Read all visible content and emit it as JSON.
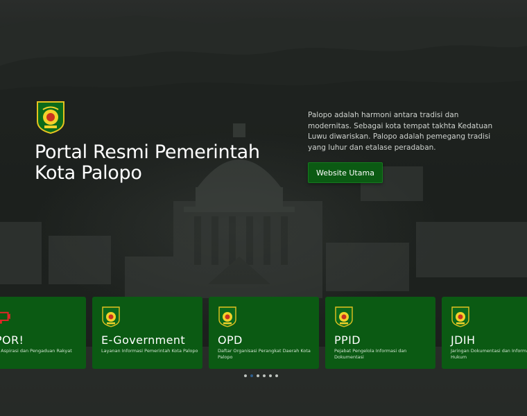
{
  "hero": {
    "title_line1": "Portal Resmi Pemerintah",
    "title_line2": "Kota Palopo",
    "intro": "Palopo adalah harmoni antara tradisi dan modernitas. Sebagai kota tempat takhta Kedatuan Luwu diwariskan. Palopo adalah pemegang tradisi yang luhur dan etalase peradaban.",
    "button_label": "Website Utama"
  },
  "cards": [
    {
      "title": "POR!",
      "desc": "n Aspirasi dan Pengaduan Rakyat",
      "icon": "megaphone-icon"
    },
    {
      "title": "E-Government",
      "desc": "Layanan Informasi Pemerintah Kota Palopo",
      "icon": "palopo-emblem-icon"
    },
    {
      "title": "OPD",
      "desc": "Daftar Organisasi Perangkat Daerah Kota Palopo",
      "icon": "palopo-emblem-icon"
    },
    {
      "title": "PPID",
      "desc": "Pejabat Pengelola Informasi dan Dokumentasi",
      "icon": "palopo-emblem-icon"
    },
    {
      "title": "JDIH",
      "desc": "Jaringan Dokumentasi dan Informasi Hukum",
      "icon": "palopo-emblem-icon"
    }
  ],
  "carousel": {
    "total": 6,
    "active": 1
  },
  "colors": {
    "brand_green": "#0b5a13",
    "background": "#1b1f1c",
    "active_dot": "#2f5f8f"
  }
}
